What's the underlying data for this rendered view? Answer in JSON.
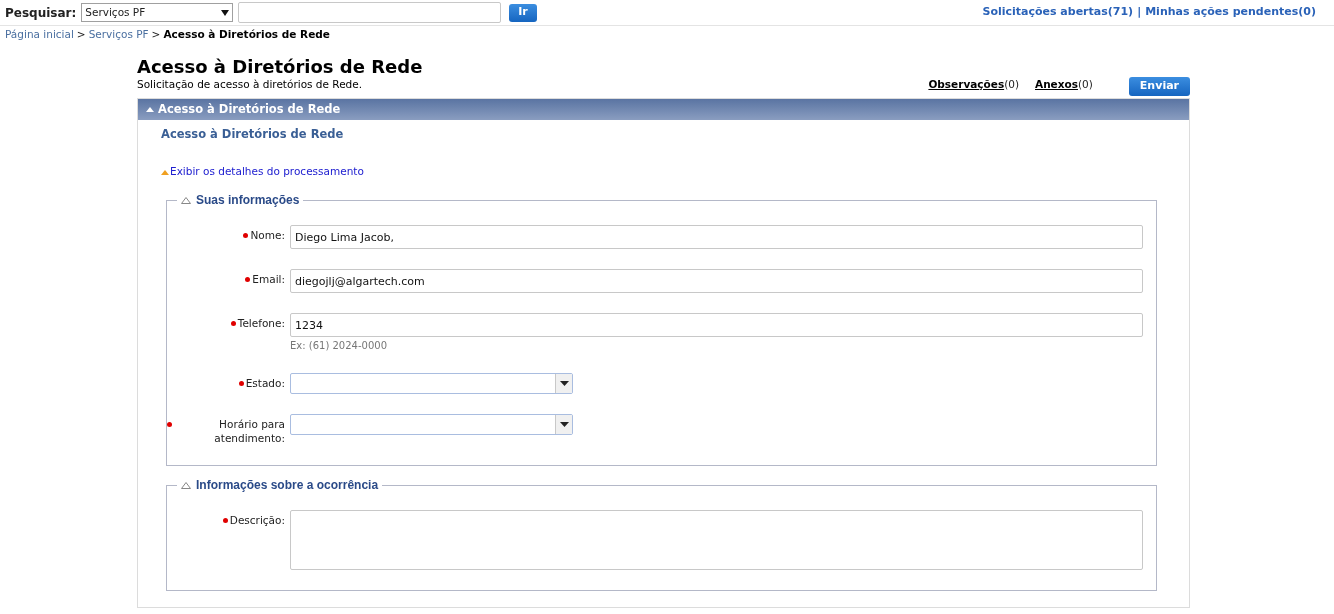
{
  "search_bar": {
    "label": "Pesquisar:",
    "scope": "Serviços PF",
    "button": "Ir"
  },
  "header_links": [
    "Solicitações abertas(71)",
    "Minhas ações pendentes(0)"
  ],
  "header_separator": "|",
  "breadcrumb_separator": ">",
  "breadcrumb": [
    {
      "label": "Página inicial",
      "current": false
    },
    {
      "label": "Serviços PF",
      "current": false
    },
    {
      "label": "Acesso à Diretórios de Rede",
      "current": true
    }
  ],
  "page": {
    "title": "Acesso à Diretórios de Rede",
    "subtitle": "Solicitação de acesso à diretórios de Rede.",
    "links": [
      {
        "label": "Observações",
        "count": "(0)"
      },
      {
        "label": "Anexos",
        "count": "(0)"
      }
    ],
    "submit": "Enviar"
  },
  "panel": {
    "title": "Acesso à Diretórios de Rede",
    "expanded": true,
    "subtitle": "Acesso à Diretórios de Rede",
    "details_link": "Exibir os detalhes do processamento",
    "sections": [
      {
        "title": "Suas informações",
        "expanded": true,
        "fields": [
          {
            "kind": "text",
            "label": "Nome:",
            "required": true,
            "value": "Diego Lima Jacob,"
          },
          {
            "kind": "text",
            "label": "Email:",
            "required": true,
            "value": "diegojlj@algartech.com"
          },
          {
            "kind": "text",
            "label": "Telefone:",
            "required": true,
            "value": "1234",
            "hint": "Ex: (61) 2024-0000"
          },
          {
            "kind": "select",
            "label": "Estado:",
            "required": true
          },
          {
            "kind": "select",
            "label": "Horário para atendimento:",
            "required": true
          }
        ]
      },
      {
        "title": "Informações sobre a ocorrência",
        "expanded": true,
        "fields": [
          {
            "kind": "textarea",
            "label": "Descrição:",
            "required": true
          }
        ]
      }
    ]
  }
}
